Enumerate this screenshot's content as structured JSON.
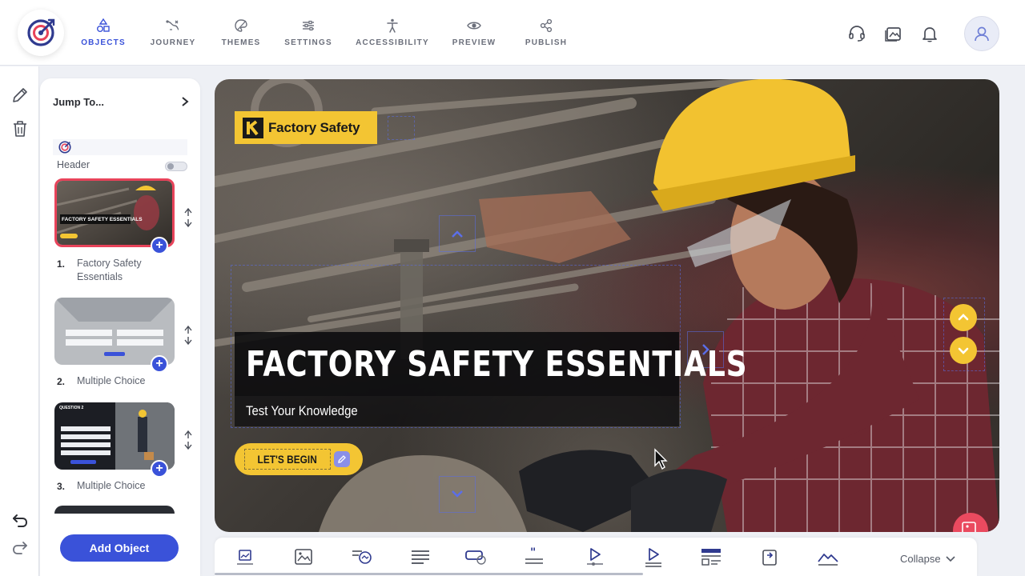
{
  "nav": {
    "items": [
      {
        "label": "OBJECTS",
        "icon": "shapes-icon",
        "active": true
      },
      {
        "label": "JOURNEY",
        "icon": "journey-icon"
      },
      {
        "label": "THEMES",
        "icon": "themes-icon"
      },
      {
        "label": "SETTINGS",
        "icon": "settings-icon"
      },
      {
        "label": "ACCESSIBILITY",
        "icon": "accessibility-icon"
      },
      {
        "label": "PREVIEW",
        "icon": "eye-icon"
      },
      {
        "label": "PUBLISH",
        "icon": "share-icon"
      }
    ],
    "accent": "#3a52d9"
  },
  "panel": {
    "jump_to": "Jump To...",
    "header_label": "Header",
    "items": [
      {
        "number": "1.",
        "label": "Factory Safety Essentials",
        "thumb_title": "FACTORY SAFETY ESSENTIALS"
      },
      {
        "number": "2.",
        "label": "Multiple Choice"
      },
      {
        "number": "3.",
        "label": "Multiple Choice",
        "thumb_title": "QUESTION 2"
      }
    ],
    "add_object": "Add Object"
  },
  "slide": {
    "brand": "Factory Safety",
    "title": "FACTORY SAFETY ESSENTIALS",
    "subtitle": "Test Your Knowledge",
    "button": "LET'S BEGIN",
    "brand_color": "#f3c533"
  },
  "toolbar": {
    "collapse": "Collapse"
  }
}
